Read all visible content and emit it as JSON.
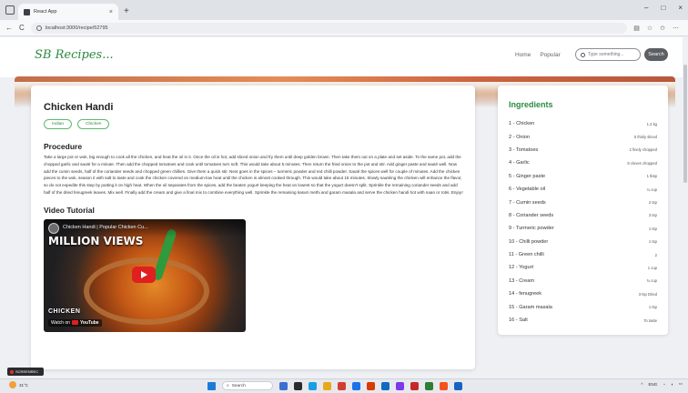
{
  "browser": {
    "tab_title": "React App",
    "tab_close": "×",
    "new_tab": "+",
    "url": "localhost:3000/recipe/52795",
    "back": "←",
    "reload": "C",
    "window_controls": [
      "–",
      "□",
      "×"
    ]
  },
  "site": {
    "logo": "SB Recipes...",
    "nav": [
      "Home",
      "Popular"
    ],
    "search_placeholder": "Type something...",
    "search_button": "Search"
  },
  "recipe": {
    "title": "Chicken Handi",
    "tags": [
      "Indian",
      "Chicken"
    ],
    "procedure_heading": "Procedure",
    "procedure": "Take a large pot or wok, big enough to cook all the chicken, and heat the oil in it. Once the oil is hot, add sliced onion and fry them until deep golden brown. Then take them out on a plate and set aside. To the same pot, add the chopped garlic and sauté for a minute. Then add the chopped tomatoes and cook until tomatoes turn soft. This would take about 5 minutes. Then return the fried onion to the pot and stir. Add ginger paste and sauté well. Now add the cumin seeds, half of the coriander seeds and chopped green chillies. Give them a quick stir. Next goes in the spices – turmeric powder and red chilli powder. Sauté the spices well for couple of minutes. Add the chicken pieces to the wok, season it with salt to taste and cook the chicken covered on medium-low heat until the chicken is almost cooked through. This would take about 15 minutes. Slowly sautéing the chicken will enhance the flavor, so do not expedite this step by putting it on high heat. When the oil separates from the spices, add the beaten yogurt keeping the heat on lowest so that the yogurt doesn't split. Sprinkle the remaining coriander seeds and add half of the dried fenugreek leaves. Mix well. Finally add the cream and give a final mix to combine everything well. Sprinkle the remaining kasuri methi and garam masala and serve the chicken handi hot with naan or rotis. Enjoy!",
    "video_heading": "Video Tutorial",
    "video": {
      "title": "Chicken Handi | Popular Chicken Cu...",
      "overlay_text": "MILLION VIEWS",
      "bottom_text": "CHICKEN",
      "watch_on": "Watch on",
      "youtube": "YouTube"
    }
  },
  "ingredients": {
    "heading": "Ingredients",
    "items": [
      {
        "name": "1 - Chicken",
        "qty": "1.2 kg"
      },
      {
        "name": "2 - Onion",
        "qty": "5 thinly sliced"
      },
      {
        "name": "3 - Tomatoes",
        "qty": "2 finely chopped"
      },
      {
        "name": "4 - Garlic",
        "qty": "8 cloves chopped"
      },
      {
        "name": "5 - Ginger paste",
        "qty": "1 tbsp"
      },
      {
        "name": "6 - Vegetable oil",
        "qty": "¼ cup"
      },
      {
        "name": "7 - Cumin seeds",
        "qty": "2 tsp"
      },
      {
        "name": "8 - Coriander seeds",
        "qty": "3 tsp"
      },
      {
        "name": "9 - Turmeric powder",
        "qty": "1 tsp"
      },
      {
        "name": "10 - Chilli powder",
        "qty": "1 tsp"
      },
      {
        "name": "11 - Green chilli",
        "qty": "2"
      },
      {
        "name": "12 - Yogurt",
        "qty": "1 cup"
      },
      {
        "name": "13 - Cream",
        "qty": "¾ cup"
      },
      {
        "name": "14 - fenugreek",
        "qty": "3 tsp Dried"
      },
      {
        "name": "15 - Garam masala",
        "qty": "1 tsp"
      },
      {
        "name": "16 - Salt",
        "qty": "To taste"
      }
    ]
  },
  "taskbar": {
    "weather": "31°C",
    "search": "Search",
    "tray_lang": "ENG",
    "recording": "SCREENREC"
  }
}
